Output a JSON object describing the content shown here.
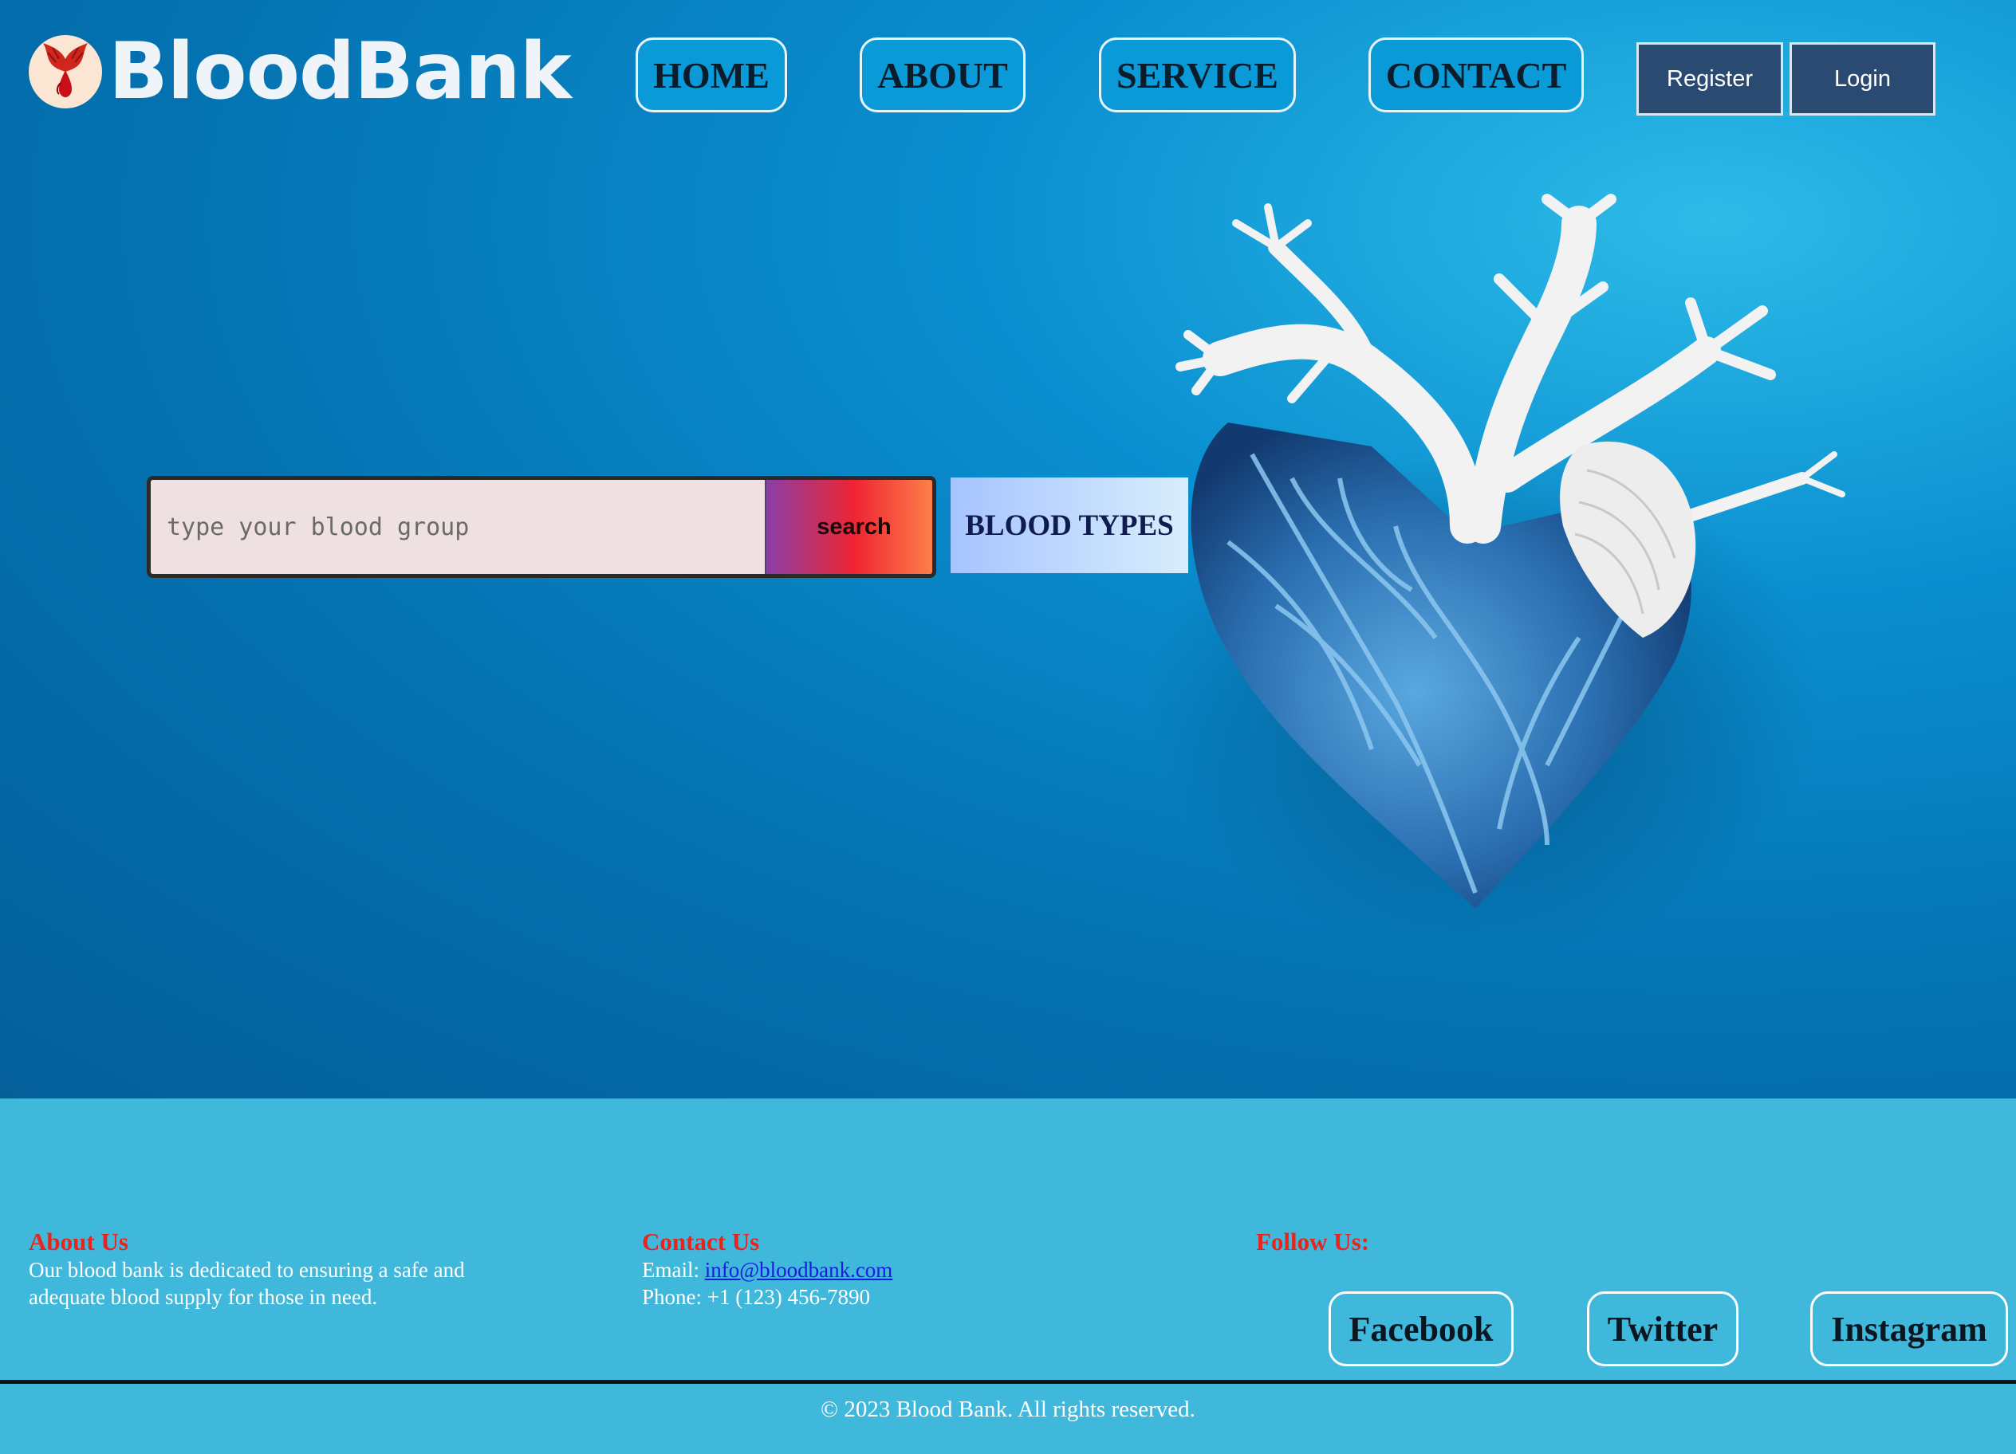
{
  "brand": {
    "name": "BloodBank",
    "logo_icon": "blood-drop-wings-icon"
  },
  "nav": {
    "items": [
      {
        "label": "HOME"
      },
      {
        "label": "ABOUT"
      },
      {
        "label": "SERVICE"
      },
      {
        "label": "CONTACT"
      }
    ],
    "register_label": "Register",
    "login_label": "Login"
  },
  "search": {
    "placeholder": "type your blood group",
    "value": "",
    "button_label": "search"
  },
  "blood_types_label": "BLOOD TYPES",
  "hero_image": "anatomical-heart-illustration",
  "footer": {
    "about": {
      "title": "About Us",
      "text": "Our blood bank is dedicated to ensuring a safe and adequate blood supply for those in need."
    },
    "contact": {
      "title": "Contact Us",
      "email_label": "Email:",
      "email": "info@bloodbank.com",
      "phone": "Phone: +1 (123) 456-7890"
    },
    "follow": {
      "title": "Follow Us:",
      "links": [
        {
          "label": "Facebook"
        },
        {
          "label": "Twitter"
        },
        {
          "label": "Instagram"
        }
      ]
    },
    "copyright": "© 2023 Blood Bank. All rights reserved."
  },
  "colors": {
    "hero_blue": "#0471b0",
    "footer_blue": "#40b8dc",
    "auth_button": "#2a4a72",
    "footer_heading": "#e8241c"
  }
}
